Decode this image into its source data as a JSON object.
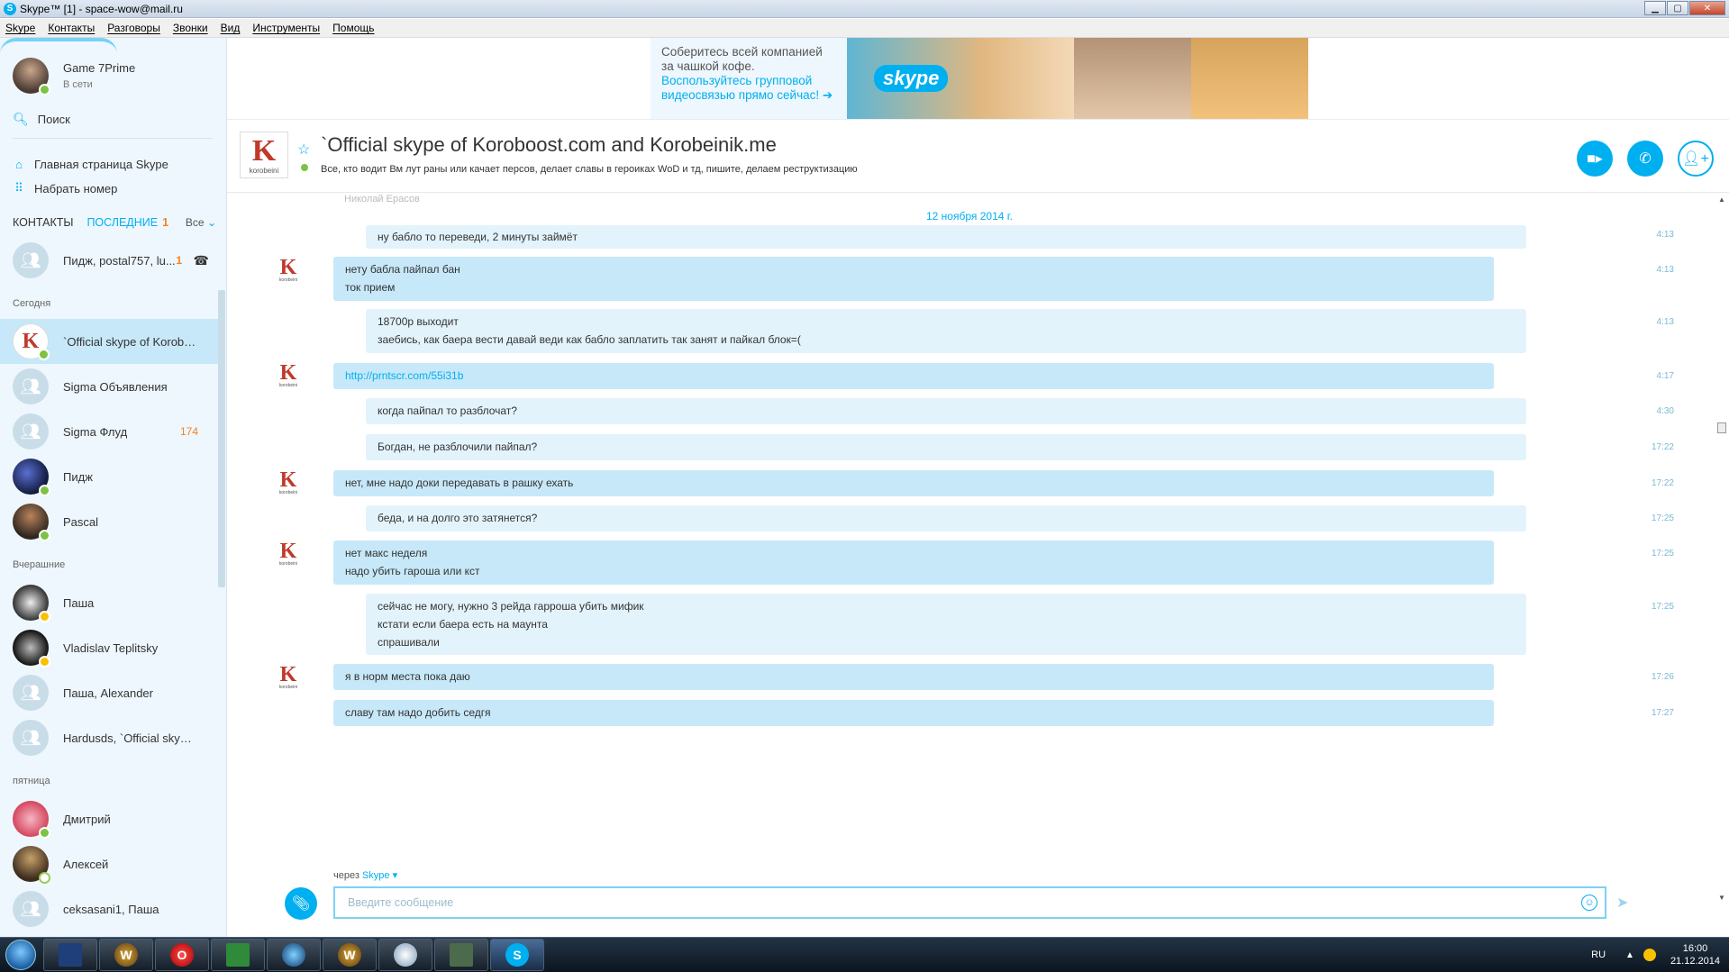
{
  "window": {
    "title": "Skype™ [1] - space-wow@mail.ru"
  },
  "menu": [
    "Skype",
    "Контакты",
    "Разговоры",
    "Звонки",
    "Вид",
    "Инструменты",
    "Помощь"
  ],
  "profile": {
    "name": "Game 7Prime",
    "status": "В сети"
  },
  "sidebar": {
    "search_label": "Поиск",
    "home_label": "Главная страница Skype",
    "dial_label": "Набрать номер",
    "tab_contacts": "КОНТАКТЫ",
    "tab_recent": "ПОСЛЕДНИЕ",
    "recent_count": "1",
    "filter": "Все",
    "top_contact": {
      "name": "Пидж, postal757, lu...",
      "badge": "1"
    },
    "sections": {
      "today": "Сегодня",
      "yesterday": "Вчерашние",
      "friday": "пятница"
    },
    "today_contacts": [
      {
        "name": "`Official skype of Korobo...",
        "badge": ""
      },
      {
        "name": "Sigma Объявления",
        "badge": ""
      },
      {
        "name": "Sigma Флуд",
        "badge": "174"
      },
      {
        "name": "Пидж",
        "badge": ""
      },
      {
        "name": "Pascal",
        "badge": ""
      }
    ],
    "yesterday_contacts": [
      {
        "name": "Паша"
      },
      {
        "name": "Vladislav Teplitsky"
      },
      {
        "name": "Паша, Alexander"
      },
      {
        "name": "Hardusds, `Official skype..."
      }
    ],
    "friday_contacts": [
      {
        "name": "Дмитрий"
      },
      {
        "name": "Алексей"
      },
      {
        "name": "ceksasani1, Паша"
      }
    ]
  },
  "ad": {
    "line1": "Соберитесь всей компанией за чашкой кофе.",
    "line2": "Воспользуйтесь групповой видеосвязью прямо сейчас! ➔",
    "logo": "skype"
  },
  "conversation": {
    "title": "`Official skype of Koroboost.com and Korobeinik.me",
    "description": "Все, кто водит Вм лут раны или качает персов, делает славы в героиках WoD и тд, пишите, делаем реструктизацию",
    "avatar_letter": "K",
    "avatar_sub": "korobeini",
    "faded_text": "Николай Ерасов",
    "date": "12 ноября 2014 г.",
    "messages": [
      {
        "lines": [
          "ну бабло то переведи, 2 минуты займёт"
        ],
        "time": "4:13"
      },
      {
        "lines": [
          "нету бабла пайпал бан",
          "ток прием"
        ],
        "time": "4:13"
      },
      {
        "lines": [
          "18700р выходит",
          "заебись, как баера вести давай веди как бабло заплатить так занят и пайкал блок=("
        ],
        "time": "4:13"
      },
      {
        "lines": [
          "http://prntscr.com/55i31b"
        ],
        "time": "4:17"
      },
      {
        "lines": [
          "когда пайпал то разблочат?"
        ],
        "time": "4:30"
      },
      {
        "lines": [
          "Богдан, не разблочили пайпал?"
        ],
        "time": "17:22"
      },
      {
        "lines": [
          "нет, мне надо доки передавать в рашку ехать"
        ],
        "time": "17:22"
      },
      {
        "lines": [
          "беда, и на долго это затянется?"
        ],
        "time": "17:25"
      },
      {
        "lines": [
          "нет макс неделя",
          "надо убить гароша или кст"
        ],
        "time": "17:25"
      },
      {
        "lines": [
          "сейчас не могу, нужно 3 рейда гарроша убить мифик",
          "кстати если баера есть на маунта",
          "спрашивали"
        ],
        "time": "17:25"
      },
      {
        "lines": [
          "я в норм места пока даю"
        ],
        "time": "17:26"
      },
      {
        "lines": [
          "славу там надо добить седгя"
        ],
        "time": "17:27"
      }
    ],
    "via_label": "через",
    "via_service": "Skype",
    "input_placeholder": "Введите сообщение"
  },
  "taskbar": {
    "lang": "RU",
    "time": "16:00",
    "date": "21.12.2014"
  },
  "colors": {
    "accent": "#00aff0",
    "incoming_bubble": "#c7e8f8",
    "outgoing_bubble": "#e3f3fb",
    "badge": "#f58220",
    "online": "#7dc242"
  }
}
